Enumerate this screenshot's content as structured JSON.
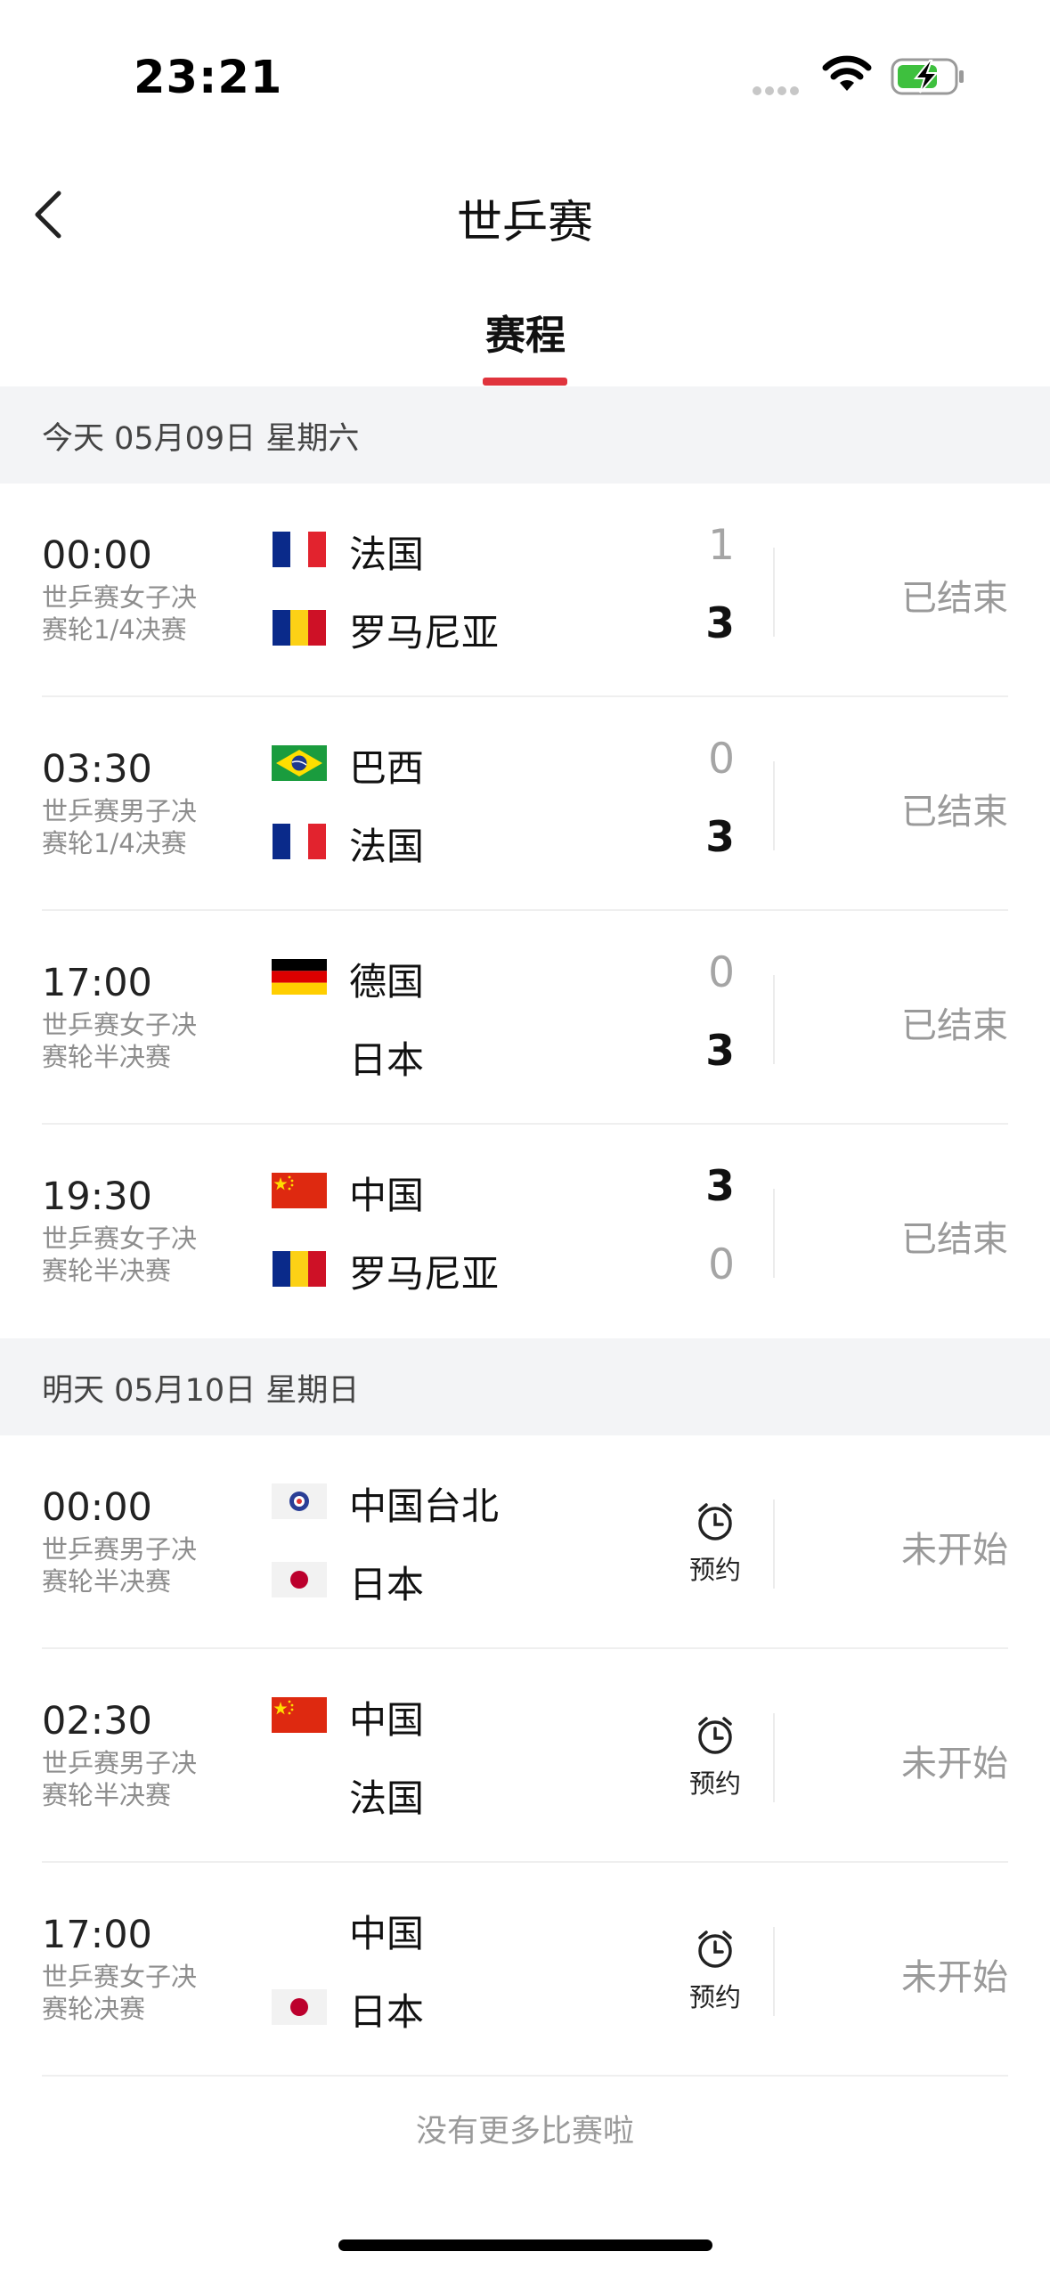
{
  "status_bar": {
    "time": "23:21"
  },
  "nav": {
    "title": "世乒赛",
    "tab": "赛程"
  },
  "colors": {
    "accent": "#e0343d",
    "battery": "#3ec03e"
  },
  "days": [
    {
      "label": "今天  05月09日  星期六",
      "matches": [
        {
          "time": "00:00",
          "stage": "世乒赛女子决赛轮1/4决赛",
          "team1": {
            "name": "法国",
            "flag": "france-flag",
            "score": "1"
          },
          "team2": {
            "name": "罗马尼亚",
            "flag": "romania-flag",
            "score": "3"
          },
          "status": "已结束"
        },
        {
          "time": "03:30",
          "stage": "世乒赛男子决赛轮1/4决赛",
          "team1": {
            "name": "巴西",
            "flag": "brazil-flag",
            "score": "0"
          },
          "team2": {
            "name": "法国",
            "flag": "france-flag",
            "score": "3"
          },
          "status": "已结束"
        },
        {
          "time": "17:00",
          "stage": "世乒赛女子决赛轮半决赛",
          "team1": {
            "name": "德国",
            "flag": "germany-flag",
            "score": "0"
          },
          "team2": {
            "name": "日本",
            "flag": "",
            "score": "3"
          },
          "status": "已结束"
        },
        {
          "time": "19:30",
          "stage": "世乒赛女子决赛轮半决赛",
          "team1": {
            "name": "中国",
            "flag": "china-flag",
            "score": "3"
          },
          "team2": {
            "name": "罗马尼亚",
            "flag": "romania-flag",
            "score": "0"
          },
          "status": "已结束"
        }
      ]
    },
    {
      "label": "明天  05月10日  星期日",
      "matches": [
        {
          "time": "00:00",
          "stage": "世乒赛男子决赛轮半决赛",
          "team1": {
            "name": "中国台北",
            "flag": "chinese-taipei-flag"
          },
          "team2": {
            "name": "日本",
            "flag": "japan-flag"
          },
          "remind": "预约",
          "status": "未开始"
        },
        {
          "time": "02:30",
          "stage": "世乒赛男子决赛轮半决赛",
          "team1": {
            "name": "中国",
            "flag": "china-flag"
          },
          "team2": {
            "name": "法国",
            "flag": ""
          },
          "remind": "预约",
          "status": "未开始"
        },
        {
          "time": "17:00",
          "stage": "世乒赛女子决赛轮决赛",
          "team1": {
            "name": "中国",
            "flag": ""
          },
          "team2": {
            "name": "日本",
            "flag": "japan-flag"
          },
          "remind": "预约",
          "status": "未开始"
        }
      ]
    }
  ],
  "footer": {
    "no_more": "没有更多比赛啦"
  }
}
